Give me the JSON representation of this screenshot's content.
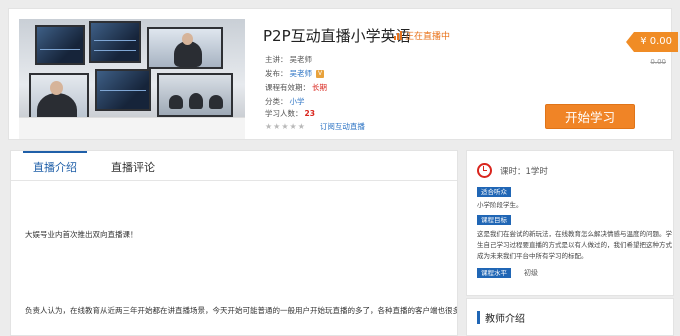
{
  "course": {
    "title": "P2P互动直播小学英语",
    "live_status": "正在直播中",
    "meta": {
      "teacher_label": "主讲：",
      "teacher_value": "吴老师",
      "publisher_label": "发布：",
      "publisher_value": "吴老师",
      "publisher_badge": "V",
      "validity_label": "课程有效期：",
      "validity_value": "长期",
      "category_label": "分类：",
      "category_value": "小学",
      "students_label": "学习人数：",
      "students_value": "23"
    },
    "rating_stars": "★★★★★",
    "subscribe_label": "订阅互动直播",
    "price": "¥ 0.00",
    "original_price": "0.00",
    "start_button": "开始学习"
  },
  "tabs": [
    {
      "label": "直播介绍",
      "active": true
    },
    {
      "label": "直播评论",
      "active": false
    }
  ],
  "content": {
    "para1": "大娱号业内首次推出双向直播课！",
    "para2": "负责人认为，在线教育从近两三年开始都在讲直播场景，今天开始可能普通的一般用户开始玩直播的多了，各种直播的客户端也很多"
  },
  "sidebar": {
    "hours_label": "课时：",
    "hours_value": "1学时",
    "audience_chip": "适合听众",
    "audience_text": "小学阶段学生。",
    "goal_chip": "课程目标",
    "goal_text": "这是我们在尝试的新玩法，在线教育怎么解决情感与温度的问题。学生自己学习过程要直播的方式是以有人做过的，我们希望把这种方式成为未来我们平台中所有学习的标配。",
    "level_chip": "课程水平",
    "level_value": "初级"
  },
  "teacher_section": {
    "title": "教师介绍"
  },
  "colors": {
    "accent_orange": "#f08426",
    "link_blue": "#2b73c4",
    "chip_blue": "#2066b5",
    "red": "#d9251d"
  }
}
